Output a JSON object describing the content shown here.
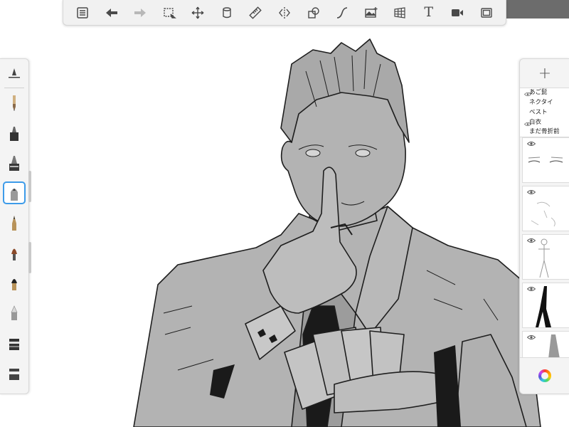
{
  "app": {
    "toolbar": {
      "items": [
        {
          "name": "menu-list-icon",
          "enabled": true
        },
        {
          "name": "undo-icon",
          "enabled": true
        },
        {
          "name": "redo-icon",
          "enabled": false
        },
        {
          "name": "selection-icon",
          "enabled": true
        },
        {
          "name": "transform-move-icon",
          "enabled": true
        },
        {
          "name": "fill-icon",
          "enabled": true
        },
        {
          "name": "ruler-icon",
          "enabled": true
        },
        {
          "name": "symmetry-icon",
          "enabled": true
        },
        {
          "name": "shape-icon",
          "enabled": true
        },
        {
          "name": "stroke-curve-icon",
          "enabled": true
        },
        {
          "name": "add-image-icon",
          "enabled": true
        },
        {
          "name": "perspective-grid-icon",
          "enabled": true
        },
        {
          "name": "text-icon",
          "enabled": true
        },
        {
          "name": "time-lapse-icon",
          "enabled": true
        },
        {
          "name": "fullscreen-icon",
          "enabled": true
        }
      ],
      "text_tool_glyph": "T"
    },
    "brushes": [
      {
        "name": "brush-size-slider-icon",
        "selected": false
      },
      {
        "name": "pencil-icon",
        "selected": false
      },
      {
        "name": "marker-icon",
        "selected": false
      },
      {
        "name": "fineliner-icon",
        "selected": false
      },
      {
        "name": "airbrush-icon",
        "selected": true
      },
      {
        "name": "ink-pen-icon",
        "selected": false
      },
      {
        "name": "paintbrush-icon",
        "selected": false
      },
      {
        "name": "chisel-brush-icon",
        "selected": false
      },
      {
        "name": "soft-eraser-icon",
        "selected": false
      },
      {
        "name": "smudge-icon",
        "selected": false
      },
      {
        "name": "eraser-icon",
        "selected": false
      }
    ],
    "layers": {
      "add_label": "+",
      "name_list": [
        "あご髭",
        "ネクタイ",
        "ベスト",
        "白衣",
        "まだ骨折前"
      ],
      "thumbnails": [
        {
          "name": "layer-eyes-thumbnail",
          "visible": true
        },
        {
          "name": "layer-sketch-thumbnail",
          "visible": true
        },
        {
          "name": "layer-figure-thumbnail",
          "visible": true
        },
        {
          "name": "layer-black-shape-thumbnail",
          "visible": true
        },
        {
          "name": "layer-gray-shape-thumbnail",
          "visible": true
        }
      ]
    },
    "colors": {
      "accent": "#3d9be9",
      "toolbar_bg": "#f1f1f1",
      "artwork_fill": "#b3b3b3",
      "line": "#1e1e1e"
    }
  }
}
